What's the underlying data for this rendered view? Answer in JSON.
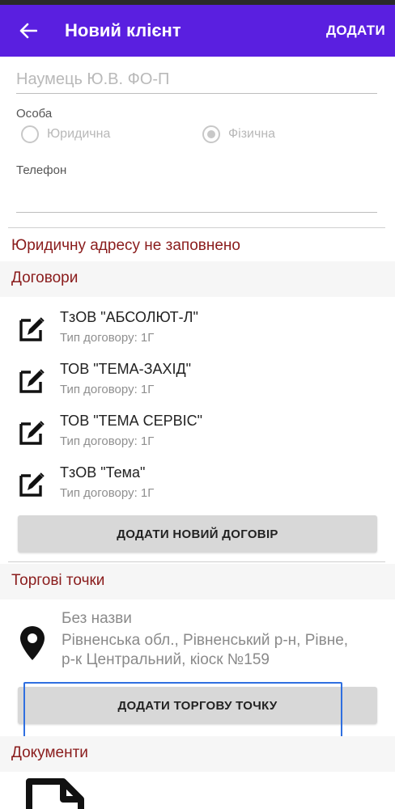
{
  "appbar": {
    "title": "Новий клієнт",
    "action_label": "ДОДАТИ",
    "color": "#5a1fe0"
  },
  "form": {
    "name_placeholder": "Наумець Ю.В. ФО-П",
    "person_label": "Особа",
    "radio_legal": "Юридична",
    "radio_individual": "Фізична",
    "selected": "Фізична",
    "phone_label": "Телефон",
    "phone_value": ""
  },
  "legal_address_warning": "Юридичну адресу не заповнено",
  "contracts": {
    "header": "Договори",
    "items": [
      {
        "name": "ТзОВ \"АБСОЛЮТ-Л\"",
        "type": "Тип договору: 1Г"
      },
      {
        "name": "ТОВ \"ТЕМА-ЗАХІД\"",
        "type": "Тип договору: 1Г"
      },
      {
        "name": "ТОВ \"ТЕМА СЕРВІС\"",
        "type": "Тип договору: 1Г"
      },
      {
        "name": "ТзОВ \"Тема\"",
        "type": "Тип договору: 1Г"
      }
    ],
    "add_button": "ДОДАТИ НОВИЙ ДОГОВІР"
  },
  "trade_points": {
    "header": "Торгові точки",
    "items": [
      {
        "name": "Без назви",
        "address": "Рівненська обл., Рівненський р-н, Рівне, р-к Центральний, кіоск №159"
      }
    ],
    "add_button": "ДОДАТИ ТОРГОВУ ТОЧКУ"
  },
  "documents": {
    "header": "Документи"
  },
  "colors": {
    "accent": "#5a1fe0",
    "section_text": "#8a1c1c",
    "highlight": "#2f6fe0"
  }
}
